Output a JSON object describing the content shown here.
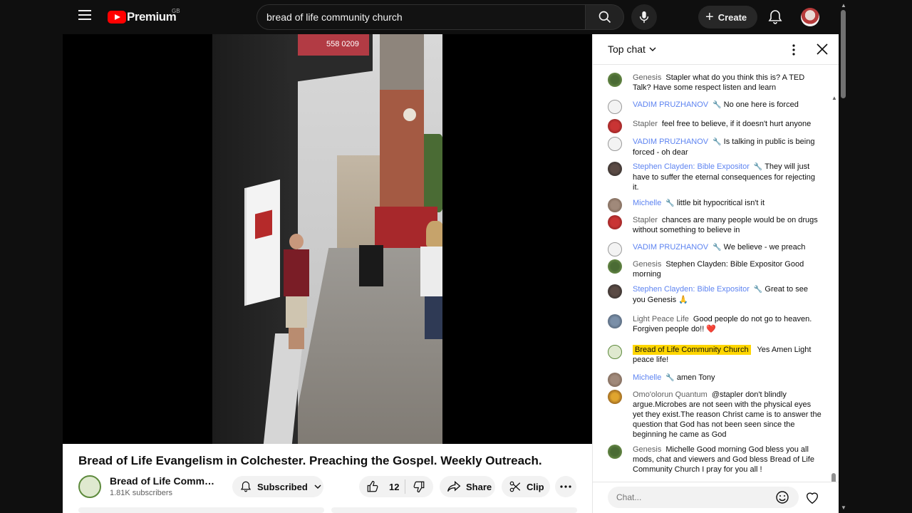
{
  "header": {
    "logo_text": "Premium",
    "region": "GB",
    "search_value": "bread of life community church",
    "create_label": "Create"
  },
  "video": {
    "title": "Bread of Life Evangelism in Colchester. Preaching the Gospel. Weekly Outreach.",
    "channel_name": "Bread of Life Community Church",
    "subscribers": "1.81K subscribers",
    "subscribe_label": "Subscribed",
    "like_count": "12",
    "share_label": "Share",
    "clip_label": "Clip",
    "sign_phone": "558 0209"
  },
  "chat": {
    "mode_label": "Top chat",
    "input_placeholder": "Chat...",
    "messages": [
      {
        "author": "Genesis",
        "role": "viewer",
        "text": "Stapler what do you think this is? A TED Talk? Have some respect listen and learn"
      },
      {
        "author": "VADIM PRUZHANOV",
        "role": "mod",
        "text": "No one here is forced"
      },
      {
        "author": "Stapler",
        "role": "viewer",
        "text": "feel free to believe, if it doesn't hurt anyone"
      },
      {
        "author": "VADIM PRUZHANOV",
        "role": "mod",
        "text": "Is talking in public is being forced - oh dear"
      },
      {
        "author": "Stephen Clayden: Bible Expositor",
        "role": "mod",
        "text": "They will just have to suffer the eternal consequences for rejecting it."
      },
      {
        "author": "Michelle",
        "role": "mod",
        "text": "little bit hypocritical isn't it"
      },
      {
        "author": "Stapler",
        "role": "viewer",
        "text": "chances are many people would be on drugs without something to believe in"
      },
      {
        "author": "VADIM PRUZHANOV",
        "role": "mod",
        "text": "We believe - we preach"
      },
      {
        "author": "Genesis",
        "role": "viewer",
        "text": "Stephen Clayden: Bible Expositor Good morning"
      },
      {
        "author": "Stephen Clayden: Bible Expositor",
        "role": "mod",
        "text": "Great to see you Genesis 🙏"
      },
      {
        "author": "Light Peace Life",
        "role": "viewer",
        "text": "Good people do not go to heaven. Forgiven people do!! ❤️"
      },
      {
        "author": "Bread of Life Community Church",
        "role": "owner",
        "text": "Yes Amen Light peace life!"
      },
      {
        "author": "Michelle",
        "role": "mod",
        "text": "amen Tony"
      },
      {
        "author": "Omo'olorun Quantum",
        "role": "viewer",
        "text": "@stapler don't blindly argue.Microbes are not seen with the physical eyes yet they exist.The reason Christ came is to answer the question that God has not been seen since the beginning he came as God"
      },
      {
        "author": "Genesis",
        "role": "viewer",
        "text": "Michelle Good morning God bless you all mods, chat and viewers and God bless Bread of Life Community Church I pray for you all !"
      }
    ]
  },
  "colors": {
    "brand_red": "#ff0000",
    "mod_blue": "#5e84f1",
    "owner_highlight": "#ffd600"
  },
  "icons": [
    "menu-icon",
    "search-icon",
    "mic-icon",
    "plus-icon",
    "bell-icon",
    "bell-outline-icon",
    "chevron-down-icon",
    "thumb-up-icon",
    "thumb-down-icon",
    "share-arrow-icon",
    "scissors-icon",
    "more-horiz-icon",
    "more-vert-icon",
    "close-icon",
    "wrench-icon",
    "emoji-icon",
    "heart-icon"
  ]
}
